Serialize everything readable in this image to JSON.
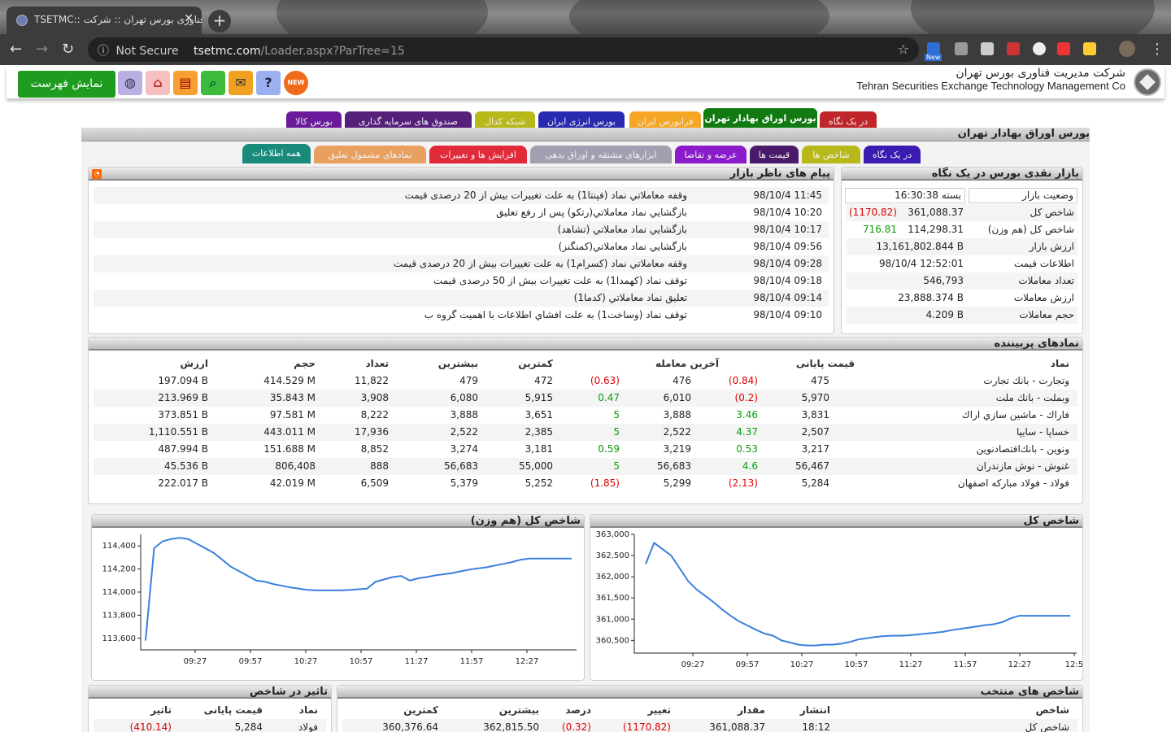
{
  "browser": {
    "tab_title": "TSETMC:: فناوری بورس تهران :: شرکت",
    "url_host": "tsetmc.com",
    "url_path": "/Loader.aspx?ParTree=15",
    "security": "Not Secure",
    "ext_badge": "New"
  },
  "header": {
    "show_list": "نمایش فهرست",
    "company_fa": "شرکت مدیریت فناوری بورس تهران",
    "company_en": "Tehran Securities Exchange Technology Management  Co",
    "new_badge": "NEW"
  },
  "main_tabs": [
    "در یک نگاه",
    "بورس اوراق بهادار تهران",
    "فرابورس ایران",
    "بورس انرژی ایران",
    "شبکه کدال",
    "صندوق های سرمایه گذاری",
    "بورس کالا"
  ],
  "page_title": "بورس اوراق بهادار تهران",
  "sub_tabs": [
    "در یک نگاه",
    "شاخص ها",
    "قیمت ها",
    "عرضه و تقاضا",
    "ابزارهای مشتقه و اوراق بدهی",
    "افزایش ها و تغییرات",
    "نمادهای مشمول تعلیق",
    "همه اطلاعات"
  ],
  "market": {
    "title": "بازار نقدی بورس در یک نگاه",
    "rows": [
      {
        "label": "وضعیت بازار",
        "value": "بسته 16:30:38",
        "change": ""
      },
      {
        "label": "شاخص کل",
        "value": "361,088.37",
        "change": "(1170.82)"
      },
      {
        "label": "شاخص کل (هم وزن)",
        "value": "114,298.31",
        "change": "716.81"
      },
      {
        "label": "ارزش بازار",
        "value": "13,161,802.844 B",
        "change": ""
      },
      {
        "label": "اطلاعات قیمت",
        "value": "98/10/4 12:52:01",
        "change": ""
      },
      {
        "label": "تعداد معاملات",
        "value": "546,793",
        "change": ""
      },
      {
        "label": "ارزش معاملات",
        "value": "23,888.374 B",
        "change": ""
      },
      {
        "label": "حجم معاملات",
        "value": "4.209 B",
        "change": ""
      }
    ]
  },
  "messages": {
    "title": "پیام های ناظر بازار",
    "rows": [
      {
        "time": "98/10/4 11:45",
        "text": "وقفه معاملاتي نماد (فپنتا1) به علت تغییرات بیش از 20 درصدی قیمت"
      },
      {
        "time": "98/10/4 10:20",
        "text": "بازگشايي نماد معاملاتي(رتكو) پس از رفع تعليق"
      },
      {
        "time": "98/10/4 10:17",
        "text": "بازگشايي نماد معاملاتي (تشاهد)"
      },
      {
        "time": "98/10/4 09:56",
        "text": "بازگشايي نماد معاملاتي(كمنگنز)"
      },
      {
        "time": "98/10/4 09:28",
        "text": "وقفه معاملاتي نماد (كسرام1) به علت تغییرات بیش از 20 درصدی قیمت"
      },
      {
        "time": "98/10/4 09:18",
        "text": "توقف نماد (كهمدا1) به علت تغییرات بیش از 50 درصدی قیمت"
      },
      {
        "time": "98/10/4 09:14",
        "text": "تعليق نماد معاملاتي (كدما1)"
      },
      {
        "time": "98/10/4 09:10",
        "text": "توقف نماد (وساخت1) به علت افشاي اطلاعات با اهميت گروه ب"
      }
    ]
  },
  "top_symbols": {
    "title": "نمادهای پربیننده",
    "headers": [
      "نماد",
      "قیمت پایانی",
      "آخرین معامله",
      "کمترین",
      "بیشترین",
      "تعداد",
      "حجم",
      "ارزش"
    ],
    "rows": [
      {
        "name": "وتجارت - بانك تجارت",
        "close": "475",
        "close_ch": "(0.84)",
        "last": "476",
        "last_ch": "(0.63)",
        "low": "472",
        "high": "479",
        "count": "11,822",
        "vol": "414.529 M",
        "val": "197.094 B",
        "cc": "red",
        "lc": "red"
      },
      {
        "name": "وبملت - بانك ملت",
        "close": "5,970",
        "close_ch": "(0.2)",
        "last": "6,010",
        "last_ch": "0.47",
        "low": "5,915",
        "high": "6,080",
        "count": "3,908",
        "vol": "35.843 M",
        "val": "213.969 B",
        "cc": "red",
        "lc": "green"
      },
      {
        "name": "فاراك - ماشين سازي اراك",
        "close": "3,831",
        "close_ch": "3.46",
        "last": "3,888",
        "last_ch": "5",
        "low": "3,651",
        "high": "3,888",
        "count": "8,222",
        "vol": "97.581 M",
        "val": "373.851 B",
        "cc": "green",
        "lc": "green"
      },
      {
        "name": "خساپا - سايپا",
        "close": "2,507",
        "close_ch": "4.37",
        "last": "2,522",
        "last_ch": "5",
        "low": "2,385",
        "high": "2,522",
        "count": "17,936",
        "vol": "443.011 M",
        "val": "1,110.551 B",
        "cc": "green",
        "lc": "green"
      },
      {
        "name": "ونوين - بانك‌اقتصادنوين",
        "close": "3,217",
        "close_ch": "0.53",
        "last": "3,219",
        "last_ch": "0.59",
        "low": "3,181",
        "high": "3,274",
        "count": "8,852",
        "vol": "151.688 M",
        "val": "487.994 B",
        "cc": "green",
        "lc": "green"
      },
      {
        "name": "غنوش - نوش مازندران",
        "close": "56,467",
        "close_ch": "4.6",
        "last": "56,683",
        "last_ch": "5",
        "low": "55,000",
        "high": "56,683",
        "count": "888",
        "vol": "806,408",
        "val": "45.536 B",
        "cc": "green",
        "lc": "green"
      },
      {
        "name": "فولاد - فولاد مباركه اصفهان",
        "close": "5,284",
        "close_ch": "(2.13)",
        "last": "5,299",
        "last_ch": "(1.85)",
        "low": "5,252",
        "high": "5,379",
        "count": "6,509",
        "vol": "42.019 M",
        "val": "222.017 B",
        "cc": "red",
        "lc": "red"
      }
    ]
  },
  "chart_data": [
    {
      "type": "line",
      "title": "شاخص کل",
      "x_ticks": [
        "09:27",
        "09:57",
        "10:27",
        "10:57",
        "11:27",
        "11:57",
        "12:27",
        "12:5"
      ],
      "y_ticks": [
        "363,000",
        "362,500",
        "362,000",
        "361,500",
        "361,000",
        "360,500"
      ],
      "ylim": [
        360200,
        363000
      ],
      "x": [
        0,
        1,
        2,
        3,
        4,
        5,
        6,
        7,
        8,
        9,
        10,
        11,
        12,
        13,
        14,
        15,
        16,
        17,
        18,
        19,
        20,
        21,
        22,
        23,
        24,
        25,
        26,
        27,
        28,
        29,
        30,
        31,
        32,
        33,
        34,
        35,
        36,
        37,
        38,
        39,
        40,
        41,
        42,
        43,
        44,
        45,
        46,
        47,
        48,
        49,
        50
      ],
      "values": [
        362300,
        362800,
        362650,
        362500,
        362200,
        361900,
        361700,
        361550,
        361400,
        361230,
        361080,
        360950,
        360850,
        360750,
        360660,
        360610,
        360500,
        360450,
        360400,
        360380,
        360380,
        360400,
        360400,
        360420,
        360460,
        360520,
        360550,
        360580,
        360600,
        360610,
        360610,
        360620,
        360640,
        360660,
        360680,
        360700,
        360740,
        360770,
        360800,
        360830,
        360860,
        360880,
        360930,
        361020,
        361080,
        361080,
        361080,
        361080,
        361080,
        361080,
        361080
      ]
    },
    {
      "type": "line",
      "title": "شاخص کل (هم وزن)",
      "x_ticks": [
        "09:27",
        "09:57",
        "10:27",
        "10:57",
        "11:27",
        "11:57",
        "12:27"
      ],
      "y_ticks": [
        "114,400",
        "114,200",
        "114,000",
        "113,800",
        "113,600"
      ],
      "ylim": [
        113500,
        114500
      ],
      "x": [
        0,
        1,
        2,
        3,
        4,
        5,
        6,
        7,
        8,
        9,
        10,
        11,
        12,
        13,
        14,
        15,
        16,
        17,
        18,
        19,
        20,
        21,
        22,
        23,
        24,
        25,
        26,
        27,
        28,
        29,
        30,
        31,
        32,
        33,
        34,
        35,
        36,
        37,
        38,
        39,
        40,
        41,
        42,
        43,
        44,
        45,
        46,
        47,
        48,
        49,
        50
      ],
      "values": [
        113580,
        114380,
        114440,
        114460,
        114470,
        114460,
        114420,
        114380,
        114340,
        114280,
        114220,
        114180,
        114140,
        114100,
        114090,
        114070,
        114055,
        114040,
        114030,
        114020,
        114015,
        114015,
        114015,
        114015,
        114020,
        114025,
        114030,
        114090,
        114110,
        114130,
        114140,
        114100,
        114120,
        114130,
        114145,
        114155,
        114165,
        114180,
        114195,
        114205,
        114215,
        114230,
        114245,
        114260,
        114280,
        114290,
        114290,
        114290,
        114290,
        114290,
        114290
      ]
    }
  ],
  "selected_index": {
    "title": "شاخص های منتخب",
    "headers": [
      "شاخص",
      "انتشار",
      "مقدار",
      "تغییر",
      "درصد",
      "بیشترین",
      "کمترین"
    ],
    "row": {
      "name": "شاخص کل",
      "time": "18:12",
      "value": "361,088.37",
      "change": "(1170.82)",
      "pct": "(0.32)",
      "high": "362,815.50",
      "low": "360,376.64"
    }
  },
  "index_effect": {
    "title": "تاثیر در شاخص",
    "headers": [
      "نماد",
      "قیمت پایانی",
      "تاثیر"
    ],
    "row": {
      "name": "فولاد",
      "close": "5,284",
      "effect": "(410.14)"
    }
  }
}
